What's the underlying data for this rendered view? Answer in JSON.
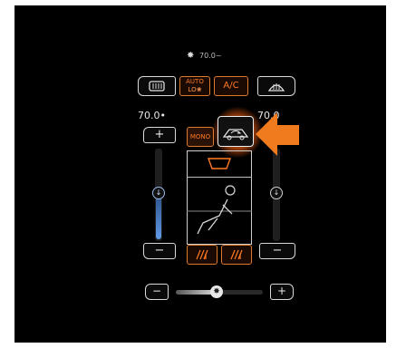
{
  "status": {
    "fan_text": "70.0~",
    "fan_icon": "fan-icon"
  },
  "top_buttons": {
    "auto_line1": "AUTO",
    "auto_line2": "LO❀",
    "ac_label": "A/C",
    "rear_defrost_icon": "rear-defrost-icon",
    "front_defrost_icon": "front-defrost-icon"
  },
  "left_zone": {
    "temperature": "70.0•",
    "plus_label": "+",
    "minus_label": "−",
    "temp_level": 0.35
  },
  "right_zone": {
    "temperature": "70.0",
    "minus_label": "−",
    "temp_level": 0.5
  },
  "center": {
    "mono_label": "MONO",
    "recirc_icon": "car-recirculation-icon",
    "windshield_icon": "windshield-airflow-icon",
    "seat_icon": "seat-airflow-icon",
    "seat_heat_left_icon": "seat-heat-icon",
    "seat_heat_right_icon": "seat-heat-icon"
  },
  "fan_speed": {
    "minus_label": "−",
    "plus_label": "+",
    "level": 0.4
  },
  "colors": {
    "accent": "#ff7a22",
    "highlight_arrow": "#f07a1e",
    "temp_blue": "#4d86d6"
  }
}
